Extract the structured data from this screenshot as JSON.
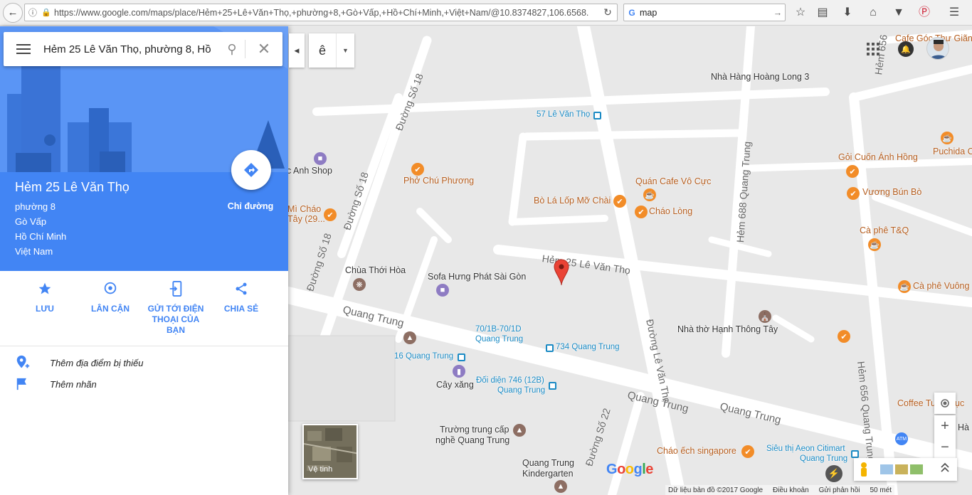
{
  "browser": {
    "url": "https://www.google.com/maps/place/Hẻm+25+Lê+Văn+Thọ,+phường+8,+Gò+Vấp,+Hồ+Chí+Minh,+Việt+Nam/@10.8374827,106.6568.",
    "search_query": "map"
  },
  "search": {
    "query": "Hẻm 25 Lê Văn Thọ, phường 8, Hồ"
  },
  "place": {
    "title": "Hẻm 25 Lê Văn Thọ",
    "address_lines": [
      "phường 8",
      "Gò Vấp",
      "Hồ Chí Minh",
      "Việt Nam"
    ],
    "directions_label": "Chỉ đường"
  },
  "actions": [
    {
      "label": "LƯU",
      "icon": "star-icon"
    },
    {
      "label": "LÂN CẬN",
      "icon": "nearby-pin-icon"
    },
    {
      "label": "GỬI TỚI ĐIỆN THOẠI CỦA BẠN",
      "icon": "send-to-phone-icon"
    },
    {
      "label": "CHIA SẺ",
      "icon": "share-icon"
    }
  ],
  "extras": {
    "add_missing": "Thêm địa điểm bị thiếu",
    "add_label": "Thêm nhãn"
  },
  "map_controls": {
    "ime_char": "ê",
    "satellite_label": "Vệ tinh",
    "zoom_in": "+",
    "zoom_out": "−"
  },
  "footer": {
    "copyright": "Dữ liệu bản đồ ©2017 Google",
    "terms": "Điều khoản",
    "feedback": "Gửi phản hồi",
    "scale": "50 mét"
  },
  "map_labels": {
    "places": [
      {
        "id": "cafe-goc",
        "text": "Cafe Góc Thư Giãn",
        "kind": "food"
      },
      {
        "id": "hoang-long",
        "text": "Nhà Hàng Hoàng Long 3",
        "kind": "plain"
      },
      {
        "id": "57-le-van-tho",
        "text": "57 Lê Văn Thọ",
        "kind": "transit"
      },
      {
        "id": "goi-cuon",
        "text": "Gỏi Cuốn Ánh Hồng",
        "kind": "food"
      },
      {
        "id": "puchida",
        "text": "Puchida C",
        "kind": "food"
      },
      {
        "id": "anh-shop",
        "text": "c Anh Shop",
        "kind": "plain"
      },
      {
        "id": "pho-chu-phuong",
        "text": "Phở Chú Phương",
        "kind": "food"
      },
      {
        "id": "quan-cafe-vo-cuc",
        "text": "Quán Cafe Vô Cực",
        "kind": "food"
      },
      {
        "id": "vuong-bun-bo",
        "text": "Vương Bún Bò",
        "kind": "food"
      },
      {
        "id": "bo-la-lop",
        "text": "Bò Lá Lốp Mỡ Chài",
        "kind": "food"
      },
      {
        "id": "chao-long",
        "text": "Cháo Lòng",
        "kind": "food"
      },
      {
        "id": "mi-chao",
        "text": "Mì Cháo",
        "kind": "food"
      },
      {
        "id": "mi-chao-2",
        "text": "Tây (29...",
        "kind": "food"
      },
      {
        "id": "ca-phe-tq",
        "text": "Cà phê T&Q",
        "kind": "food"
      },
      {
        "id": "chua-thoi-hoa",
        "text": "Chùa Thới Hòa",
        "kind": "plain"
      },
      {
        "id": "sofa",
        "text": "Sofa Hưng Phát Sài Gòn",
        "kind": "plain"
      },
      {
        "id": "ca-phe-vuong",
        "text": "Cà phê Vuông",
        "kind": "food"
      },
      {
        "id": "nha-tho",
        "text": "Nhà thờ Hạnh Thông Tây",
        "kind": "plain"
      },
      {
        "id": "70-1b",
        "text": "70/1B-70/1D",
        "kind": "transit"
      },
      {
        "id": "70-1b-2",
        "text": "Quang Trung",
        "kind": "transit"
      },
      {
        "id": "734",
        "text": "734 Quang Trung",
        "kind": "transit"
      },
      {
        "id": "16-quang-trung",
        "text": "16 Quang Trung",
        "kind": "transit"
      },
      {
        "id": "cay-xang",
        "text": "Cây xăng",
        "kind": "plain"
      },
      {
        "id": "doi-dien",
        "text": "Đối diện 746 (12B)",
        "kind": "transit"
      },
      {
        "id": "doi-dien-2",
        "text": "Quang Trung",
        "kind": "transit"
      },
      {
        "id": "coffee-tua",
        "text": "Coffee Tuấ",
        "kind": "food"
      },
      {
        "id": "ha-cut",
        "text": "Hà",
        "kind": "plain"
      },
      {
        "id": "truong-trung-cap",
        "text": "Trường trung cấp",
        "kind": "plain"
      },
      {
        "id": "truong-trung-cap-2",
        "text": "nghề Quang Trung",
        "kind": "plain"
      },
      {
        "id": "chao-ech",
        "text": "Cháo ếch singapore",
        "kind": "food"
      },
      {
        "id": "aeon",
        "text": "Siêu thị Aeon Citimart",
        "kind": "transit"
      },
      {
        "id": "aeon-2",
        "text": "Quang Trung",
        "kind": "transit"
      },
      {
        "id": "kindergarten",
        "text": "Quang Trung",
        "kind": "plain"
      },
      {
        "id": "kindergarten-2",
        "text": "Kindergarten",
        "kind": "plain"
      },
      {
        "id": "uc-cut",
        "text": "ục",
        "kind": "food"
      }
    ],
    "roads": [
      {
        "id": "duong-so-18-a",
        "text": "Đường Số 18"
      },
      {
        "id": "duong-so-18-b",
        "text": "Đường Số 18"
      },
      {
        "id": "duong-so-18-c",
        "text": "Đường Số 18"
      },
      {
        "id": "hem-688",
        "text": "Hẻm 688 Quang Trung"
      },
      {
        "id": "hem-656",
        "text": "Hẻm 656 Quang Trung"
      },
      {
        "id": "hem-656-top",
        "text": "Hẻm 656"
      },
      {
        "id": "hem-25",
        "text": "Hẻm 25 Lê Văn Thọ"
      },
      {
        "id": "le-van-tho",
        "text": "Đường Lê Văn Thọ"
      },
      {
        "id": "quang-trung-1",
        "text": "Quang Trung"
      },
      {
        "id": "quang-trung-2",
        "text": "Quang Trung"
      },
      {
        "id": "quang-trung-3",
        "text": "Quang Trung"
      },
      {
        "id": "duong-so-22",
        "text": "Đường Số 22"
      }
    ]
  },
  "colors": {
    "accent": "#4285f4",
    "food": "#f28c28",
    "transit": "#1a8ac4",
    "pin": "#ea4335"
  }
}
